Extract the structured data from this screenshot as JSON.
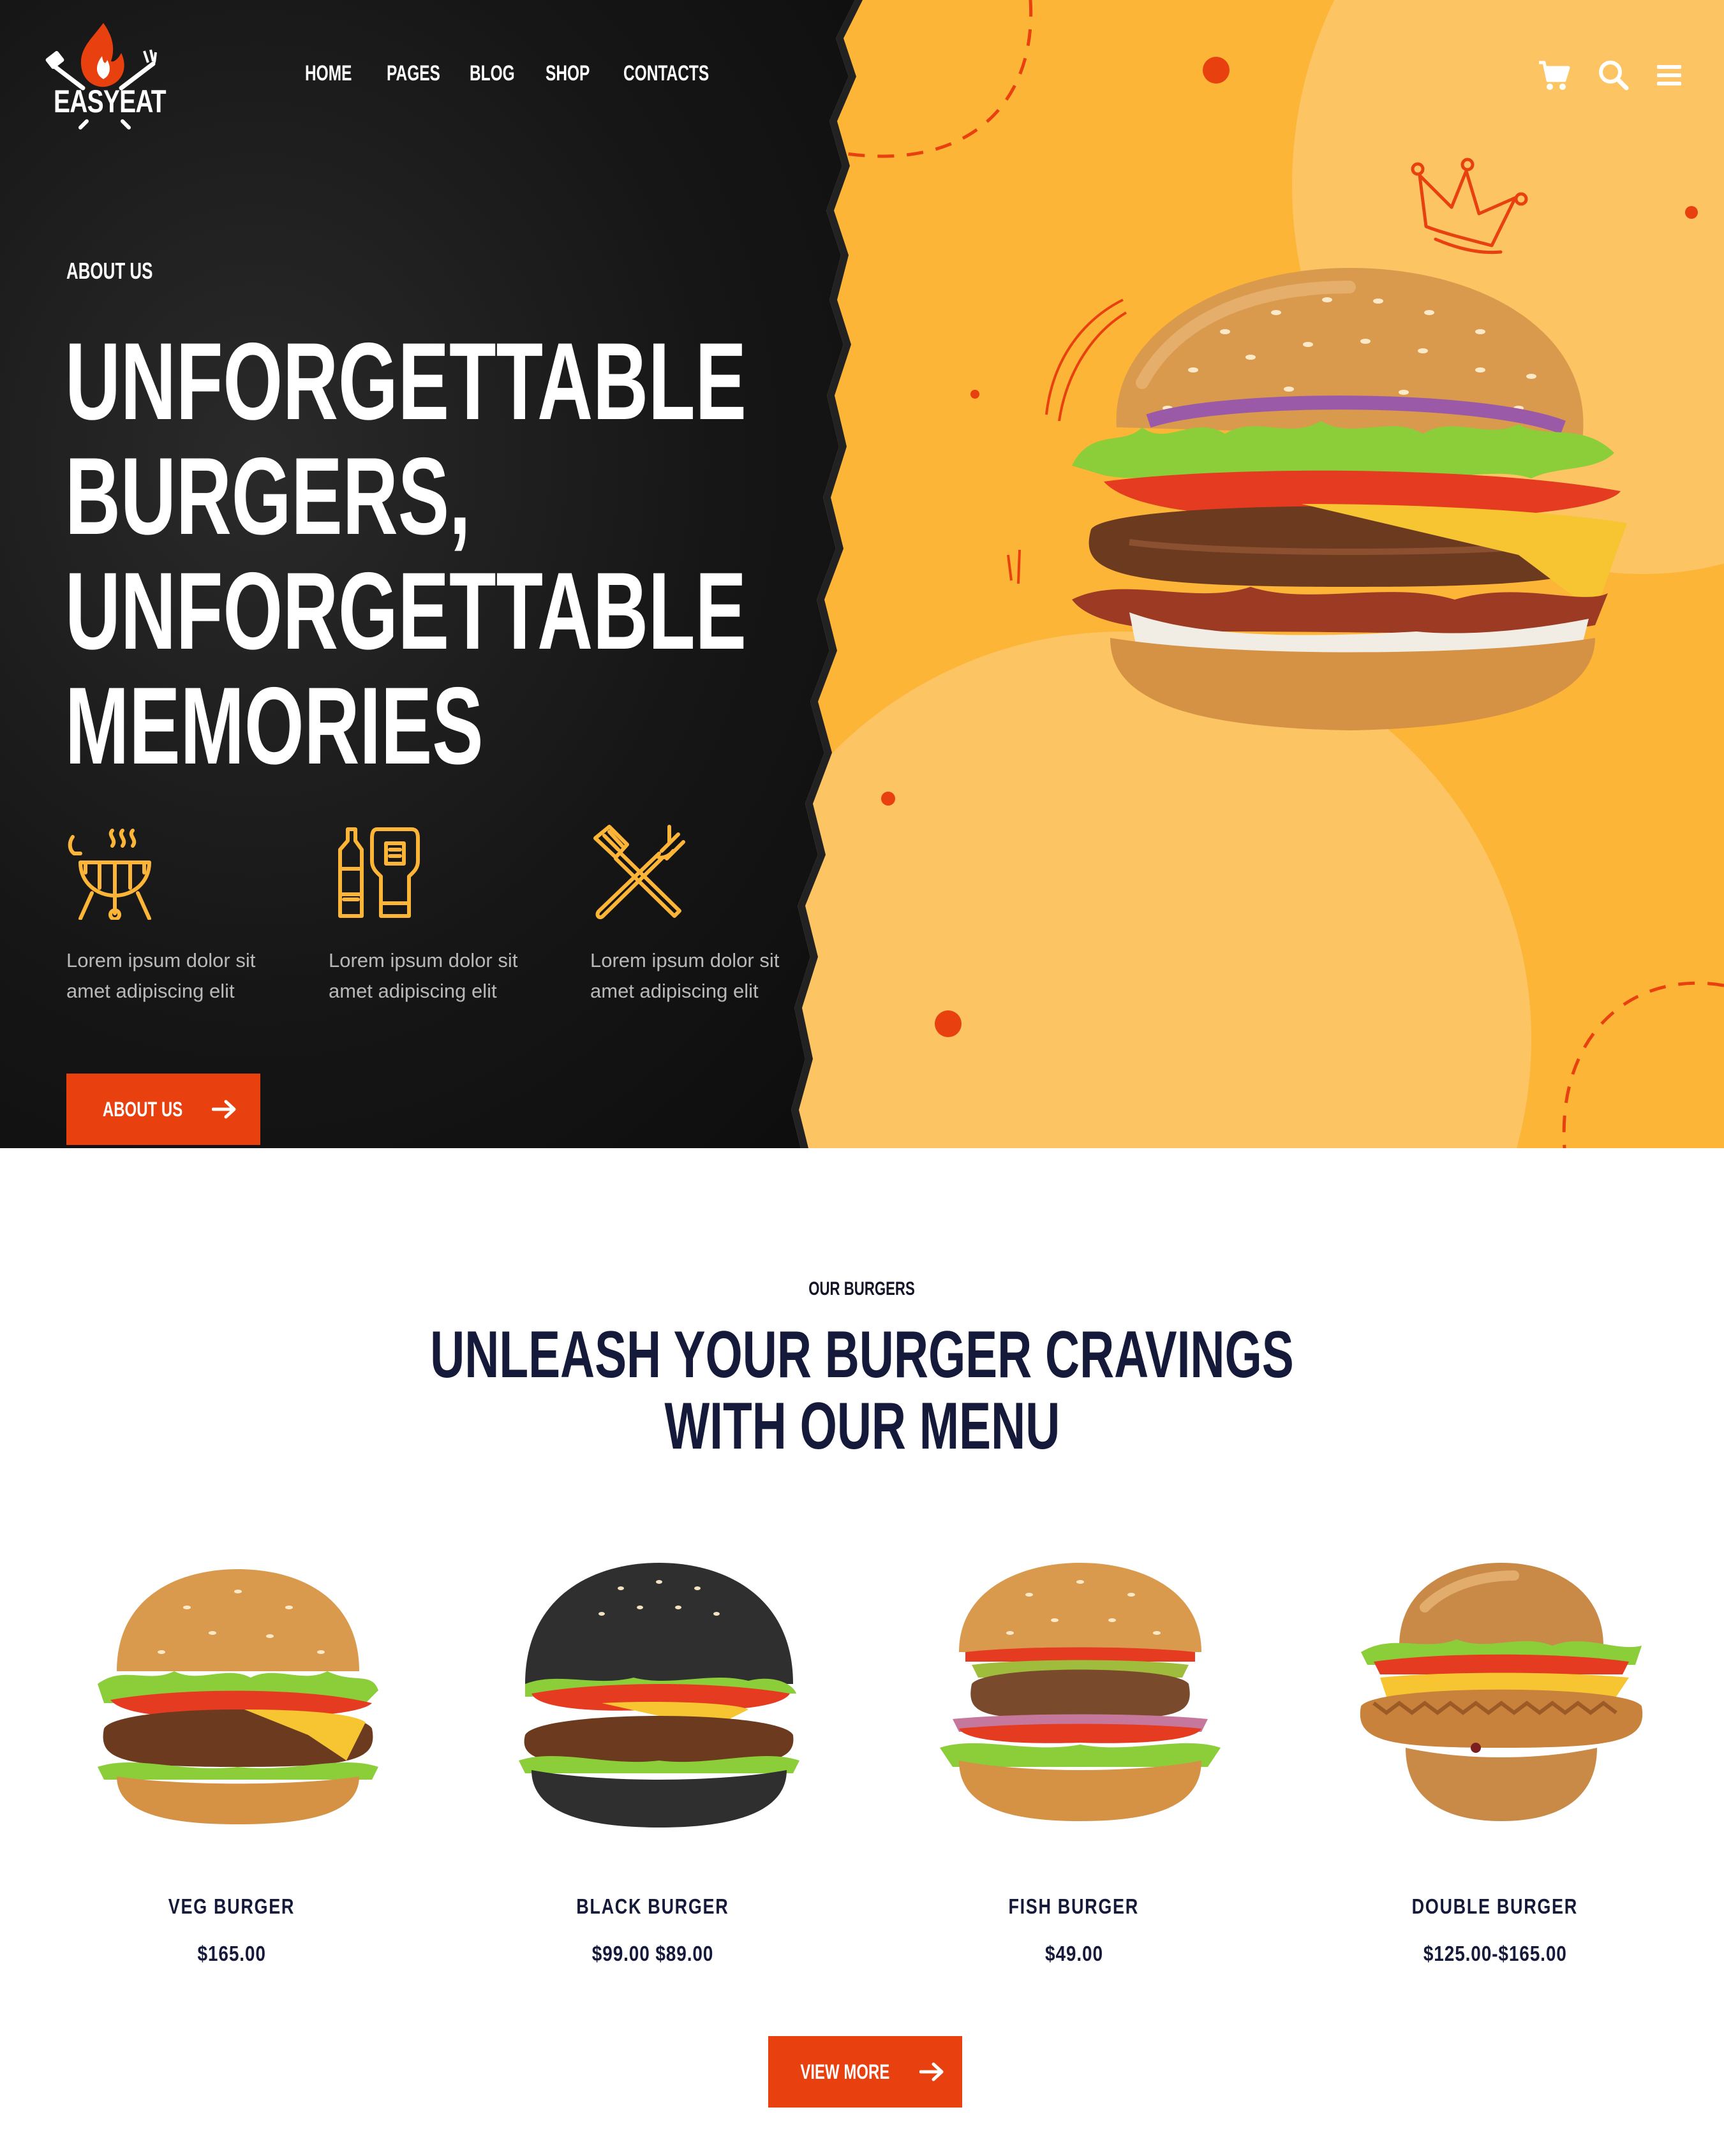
{
  "brand": {
    "name": "EASYEAT"
  },
  "nav": {
    "items": [
      "HOME",
      "PAGES",
      "BLOG",
      "SHOP",
      "CONTACTS"
    ]
  },
  "hero": {
    "eyebrow": "ABOUT US",
    "headline_lines": [
      "UNFORGETTABLE",
      "BURGERS,",
      "UNFORGETTABLE",
      "MEMORIES"
    ],
    "features": [
      {
        "icon": "grill-icon",
        "text": "Lorem ipsum dolor sit amet adipiscing elit"
      },
      {
        "icon": "sauce-bottles-icon",
        "text": "Lorem ipsum dolor sit amet adipiscing elit"
      },
      {
        "icon": "utensils-crossed-icon",
        "text": "Lorem ipsum dolor sit amet adipiscing elit"
      }
    ],
    "button_label": "ABOUT US"
  },
  "menu": {
    "eyebrow": "OUR BURGERS",
    "title_lines": [
      "UNLEASH YOUR BURGER CRAVINGS",
      "WITH OUR MENU"
    ],
    "products": [
      {
        "name": "VEG BURGER",
        "price": "$165.00"
      },
      {
        "name": "BLACK BURGER",
        "price": "$99.00  $89.00"
      },
      {
        "name": "FISH BURGER",
        "price": "$49.00"
      },
      {
        "name": "DOUBLE BURGER",
        "price": "$125.00-$165.00"
      }
    ],
    "button_label": "VIEW MORE"
  },
  "colors": {
    "accent": "#e8400f",
    "yellow": "#fdb538",
    "dark": "#151a3a"
  }
}
